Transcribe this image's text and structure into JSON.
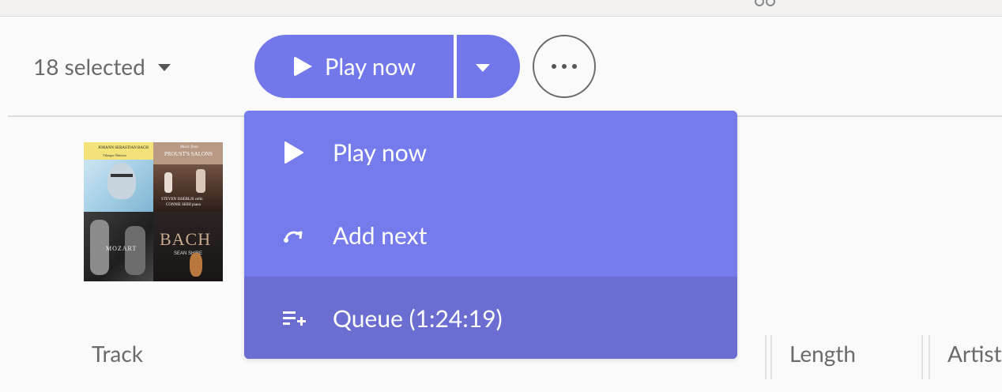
{
  "selection": {
    "label": "18 selected"
  },
  "actions": {
    "play_now_label": "Play now"
  },
  "dropdown_menu": {
    "items": [
      {
        "icon": "play-icon",
        "label": "Play now"
      },
      {
        "icon": "add-next-icon",
        "label": "Add next"
      },
      {
        "icon": "queue-add-icon",
        "label": "Queue (1:24:19)"
      }
    ]
  },
  "album_art": {
    "covers": [
      {
        "lines": [
          "JOHANN SEBASTIAN BACH",
          "Víkingur Ólafsson"
        ]
      },
      {
        "lines": [
          "Music from",
          "PROUST'S SALONS",
          "STEVEN ISSERLIS cello",
          "CONNIE SHIH piano"
        ]
      },
      {
        "lines": [
          "MOZART"
        ]
      },
      {
        "lines": [
          "BACH",
          "SEAN SHIBE"
        ]
      }
    ]
  },
  "table": {
    "columns": [
      "Track",
      "Length",
      "Artist"
    ]
  },
  "colors": {
    "accent": "#7278e9",
    "menu_bg": "#757bea",
    "menu_hover": "#6b6ed0",
    "text_muted": "#6a6a6a"
  }
}
